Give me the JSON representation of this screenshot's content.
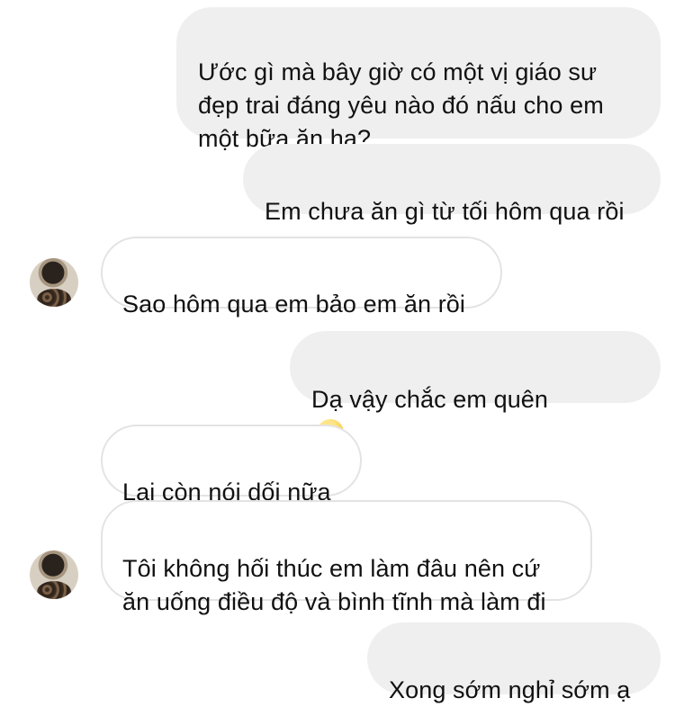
{
  "messages": [
    {
      "side": "sent",
      "text": "Ước gì mà bây giờ có một vị giáo sư\nđẹp trai đáng yêu nào đó nấu cho em\nmột bữa ăn ha?"
    },
    {
      "side": "sent",
      "text": "Em chưa ăn gì từ tối hôm qua rồi"
    },
    {
      "side": "received",
      "text": "Sao hôm qua em bảo em ăn rồi"
    },
    {
      "side": "sent",
      "text": "Dạ vậy chắc em quên",
      "emoji": "relieved-face-emoji"
    },
    {
      "side": "received",
      "text": "Lại còn nói dối nữa"
    },
    {
      "side": "received",
      "text": "Tôi không hối thúc em làm đâu nên cứ\năn uống điều độ và bình tĩnh mà làm đi"
    },
    {
      "side": "sent",
      "text": "Xong sớm nghỉ sớm ạ"
    }
  ],
  "colors": {
    "sent_bubble": "#efefef",
    "received_border": "#e3e3e3",
    "text": "#111111"
  },
  "icons": {
    "avatar": "contact-avatar",
    "emoji": "relieved-face-emoji"
  }
}
